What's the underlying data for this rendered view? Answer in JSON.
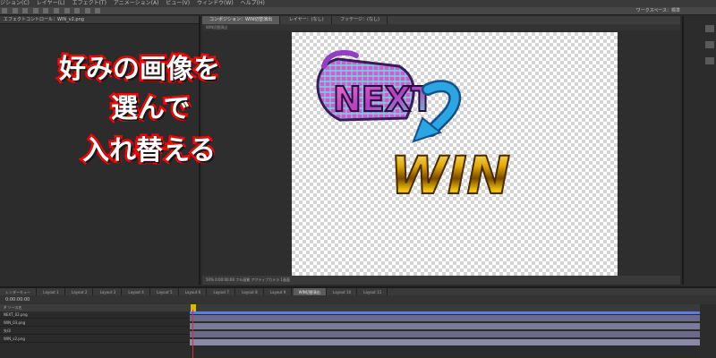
{
  "menubar": {
    "items": [
      "ジション(C)",
      "レイヤー(L)",
      "エフェクト(T)",
      "アニメーション(A)",
      "ビュー(V)",
      "ウィンドウ(W)",
      "ヘルプ(H)"
    ]
  },
  "toolbar": {
    "workspace_label": "ワークスペース：標準"
  },
  "left_panel": {
    "tab_label": "エフェクトコントロール：WIN_v2.png"
  },
  "comp_panel": {
    "tabs": [
      "コンポジション：WIN切替演出",
      "レイヤー：(なし)",
      "フッテージ：(なし)"
    ],
    "active_tab": "WIN切替演出",
    "viewer_bottom": "50%   0:00:00:00   フル画質   アクティブカメラ   1画面"
  },
  "timeline": {
    "tabs": [
      "レンダーキュー",
      "Layout 1",
      "Layout 2",
      "Layout 3",
      "Layout 4",
      "Layout 5",
      "Layout 6",
      "Layout 7",
      "Layout 8",
      "Layout 9",
      "WIN切替演出",
      "Layout 10",
      "Layout 11"
    ],
    "active_tab": "WIN切替演出",
    "time_display": "0:00:00:00",
    "header": "# ソース名",
    "layers": [
      {
        "name": "NEXT_02.png"
      },
      {
        "name": "WIN_03.png"
      },
      {
        "name": "矢印"
      },
      {
        "name": "WIN_v2.png"
      }
    ]
  },
  "headline": {
    "line1": "好みの画像を",
    "line2": "選んで",
    "line3": "入れ替える"
  },
  "graphics": {
    "next_logo": "NEXT",
    "win_logo": "WIN"
  },
  "colors": {
    "headline_stroke": "#ff0000",
    "arrow": "#2aa7e3",
    "win_gold": "#e0a800",
    "next_pink": "#e048a8"
  }
}
